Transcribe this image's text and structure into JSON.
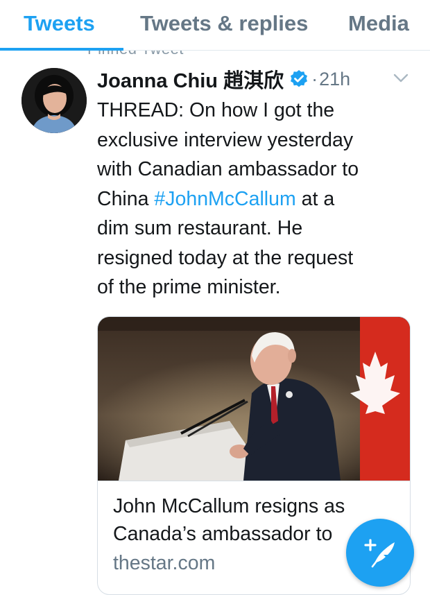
{
  "tabs": [
    {
      "label": "Tweets",
      "active": true
    },
    {
      "label": "Tweets & replies",
      "active": false
    },
    {
      "label": "Media",
      "active": false
    }
  ],
  "pinned_label": "Pinned Tweet",
  "tweet": {
    "author_name": "Joanna Chiu 趙淇欣",
    "verified": true,
    "separator": "·",
    "time": "21h",
    "text_lines": [
      "THREAD: On how I got the",
      "exclusive interview yesterday",
      "with Canadian ambassador to"
    ],
    "text_line4_pre": "China ",
    "hashtag": "#JohnMcCallum",
    "text_line4_post": " at a",
    "text_lines_after": [
      "dim sum restaurant. He",
      "resigned today at the request",
      "of the prime minister."
    ]
  },
  "card": {
    "title_line1": "John McCallum resigns as",
    "title_line2": "Canada’s ambassador to",
    "domain": "thestar.com"
  },
  "colors": {
    "accent": "#1da1f2",
    "text": "#14171a",
    "secondary": "#657786",
    "border": "#e1e8ed"
  },
  "icons": {
    "verified": "verified-badge-icon",
    "menu": "chevron-down-icon",
    "compose": "compose-tweet-icon"
  }
}
